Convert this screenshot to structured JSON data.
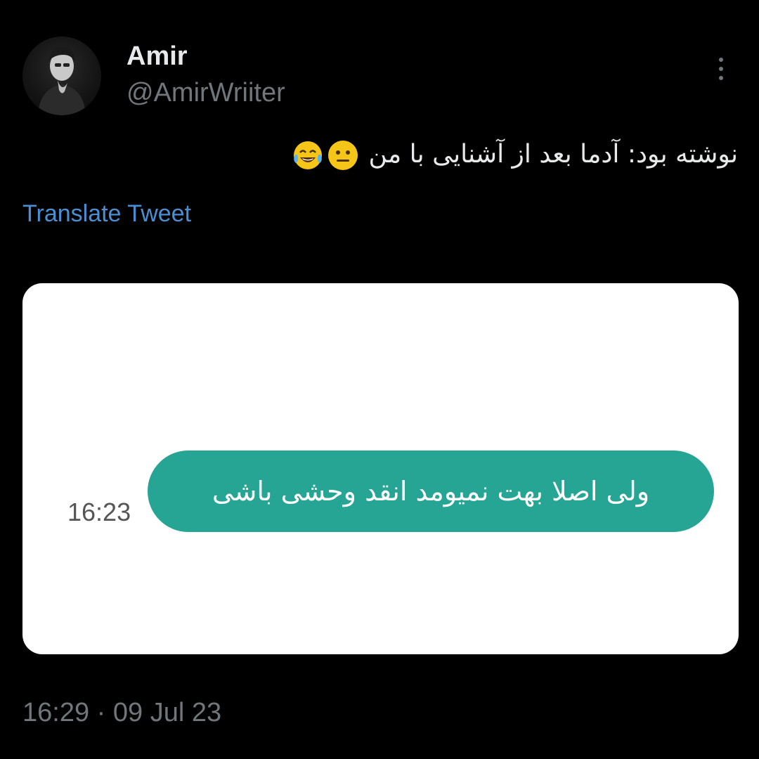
{
  "tweet": {
    "author": {
      "display_name": "Amir",
      "handle": "@AmirWriiter"
    },
    "text": "نوشته بود: آدما بعد از آشنایی با من",
    "emojis": [
      "neutral-face",
      "tears-of-joy"
    ],
    "translate_label": "Translate Tweet",
    "timestamp": "16:29 · 09 Jul 23"
  },
  "media": {
    "message": {
      "text": "ولی اصلا بهت نمیومد انقد وحشی باشی",
      "time": "16:23",
      "bubble_color": "#26a594"
    }
  },
  "colors": {
    "background": "#000000",
    "link": "#4a8fd4",
    "secondary_text": "#71767b"
  }
}
